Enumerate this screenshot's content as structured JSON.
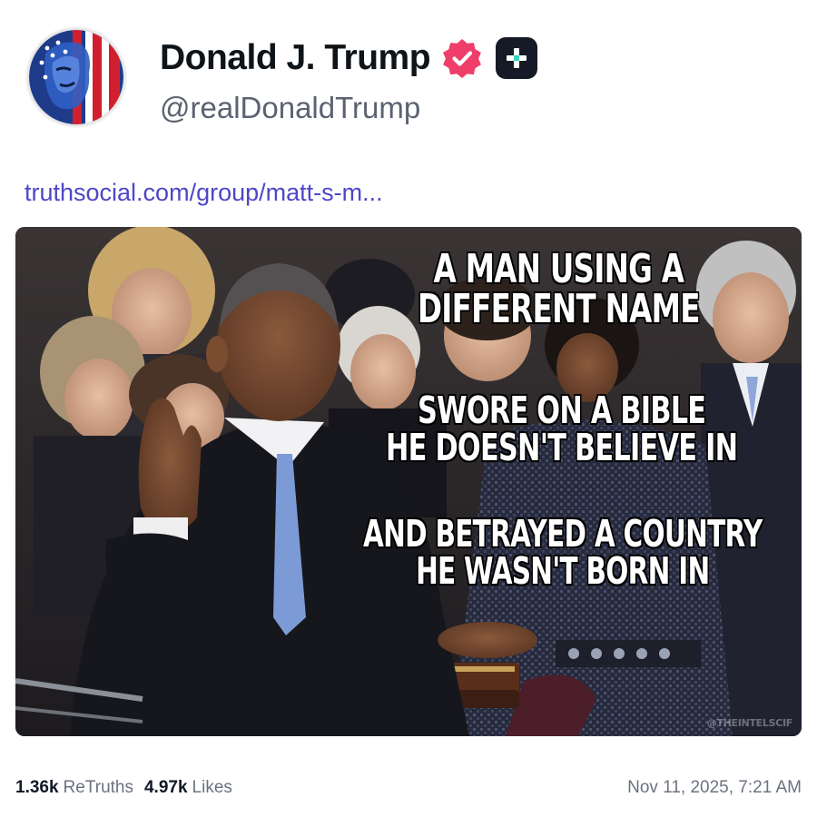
{
  "author": {
    "display_name": "Donald J. Trump",
    "handle": "@realDonaldTrump",
    "verified_badge_color": "#ef3e6a",
    "plus_badge_color": "#151a26"
  },
  "post": {
    "link_text": "truthsocial.com/group/matt-s-m...",
    "link_color": "#4f46c7",
    "image": {
      "caption_lines_1": [
        "A MAN USING A",
        "DIFFERENT NAME"
      ],
      "caption_lines_2": [
        "SWORE ON A BIBLE",
        "HE DOESN'T BELIEVE IN"
      ],
      "caption_lines_3": [
        "AND BETRAYED A COUNTRY",
        "HE WASN'T BORN IN"
      ],
      "watermark": "@THEINTELSCIF"
    }
  },
  "stats": {
    "retruths_count": "1.36k",
    "retruths_label": "ReTruths",
    "likes_count": "4.97k",
    "likes_label": "Likes"
  },
  "timestamp": "Nov 11, 2025, 7:21 AM"
}
